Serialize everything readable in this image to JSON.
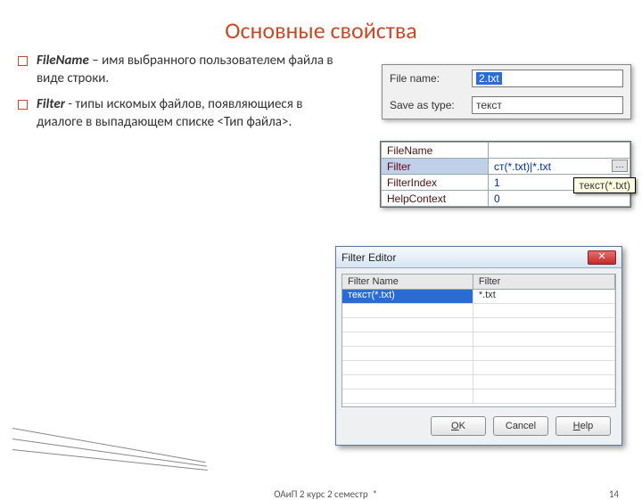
{
  "title": "Основные свойства",
  "bullets": [
    {
      "term": "FileName",
      "text": "– имя выбранного пользователем файла в виде строки."
    },
    {
      "term": "Filter",
      "text": "- типы искомых файлов, появляющиеся в диалоге в выпадающем списке <Тип файла>."
    }
  ],
  "shot1": {
    "filenameLabel": "File name:",
    "filenameValue": "2.txt",
    "saveTypeLabel": "Save as type:",
    "saveTypeValue": "текст"
  },
  "shot2": {
    "rows": [
      {
        "name": "FileName",
        "value": ""
      },
      {
        "name": "Filter",
        "value": "ст(*.txt)|*.txt"
      },
      {
        "name": "FilterIndex",
        "value": "1"
      },
      {
        "name": "HelpContext",
        "value": "0"
      }
    ],
    "ellipsis": "…",
    "hint": "текст(*.txt)"
  },
  "shot3": {
    "title": "Filter Editor",
    "cols": [
      "Filter Name",
      "Filter"
    ],
    "row": {
      "name": "текст(*.txt)",
      "filter": "*.txt"
    },
    "buttons": {
      "ok": "OK",
      "cancel": "Cancel",
      "help": "Help"
    },
    "close": "✕"
  },
  "footer": {
    "mid": "ОАиП 2 курс 2 семестр",
    "star": "*",
    "page": "14"
  }
}
